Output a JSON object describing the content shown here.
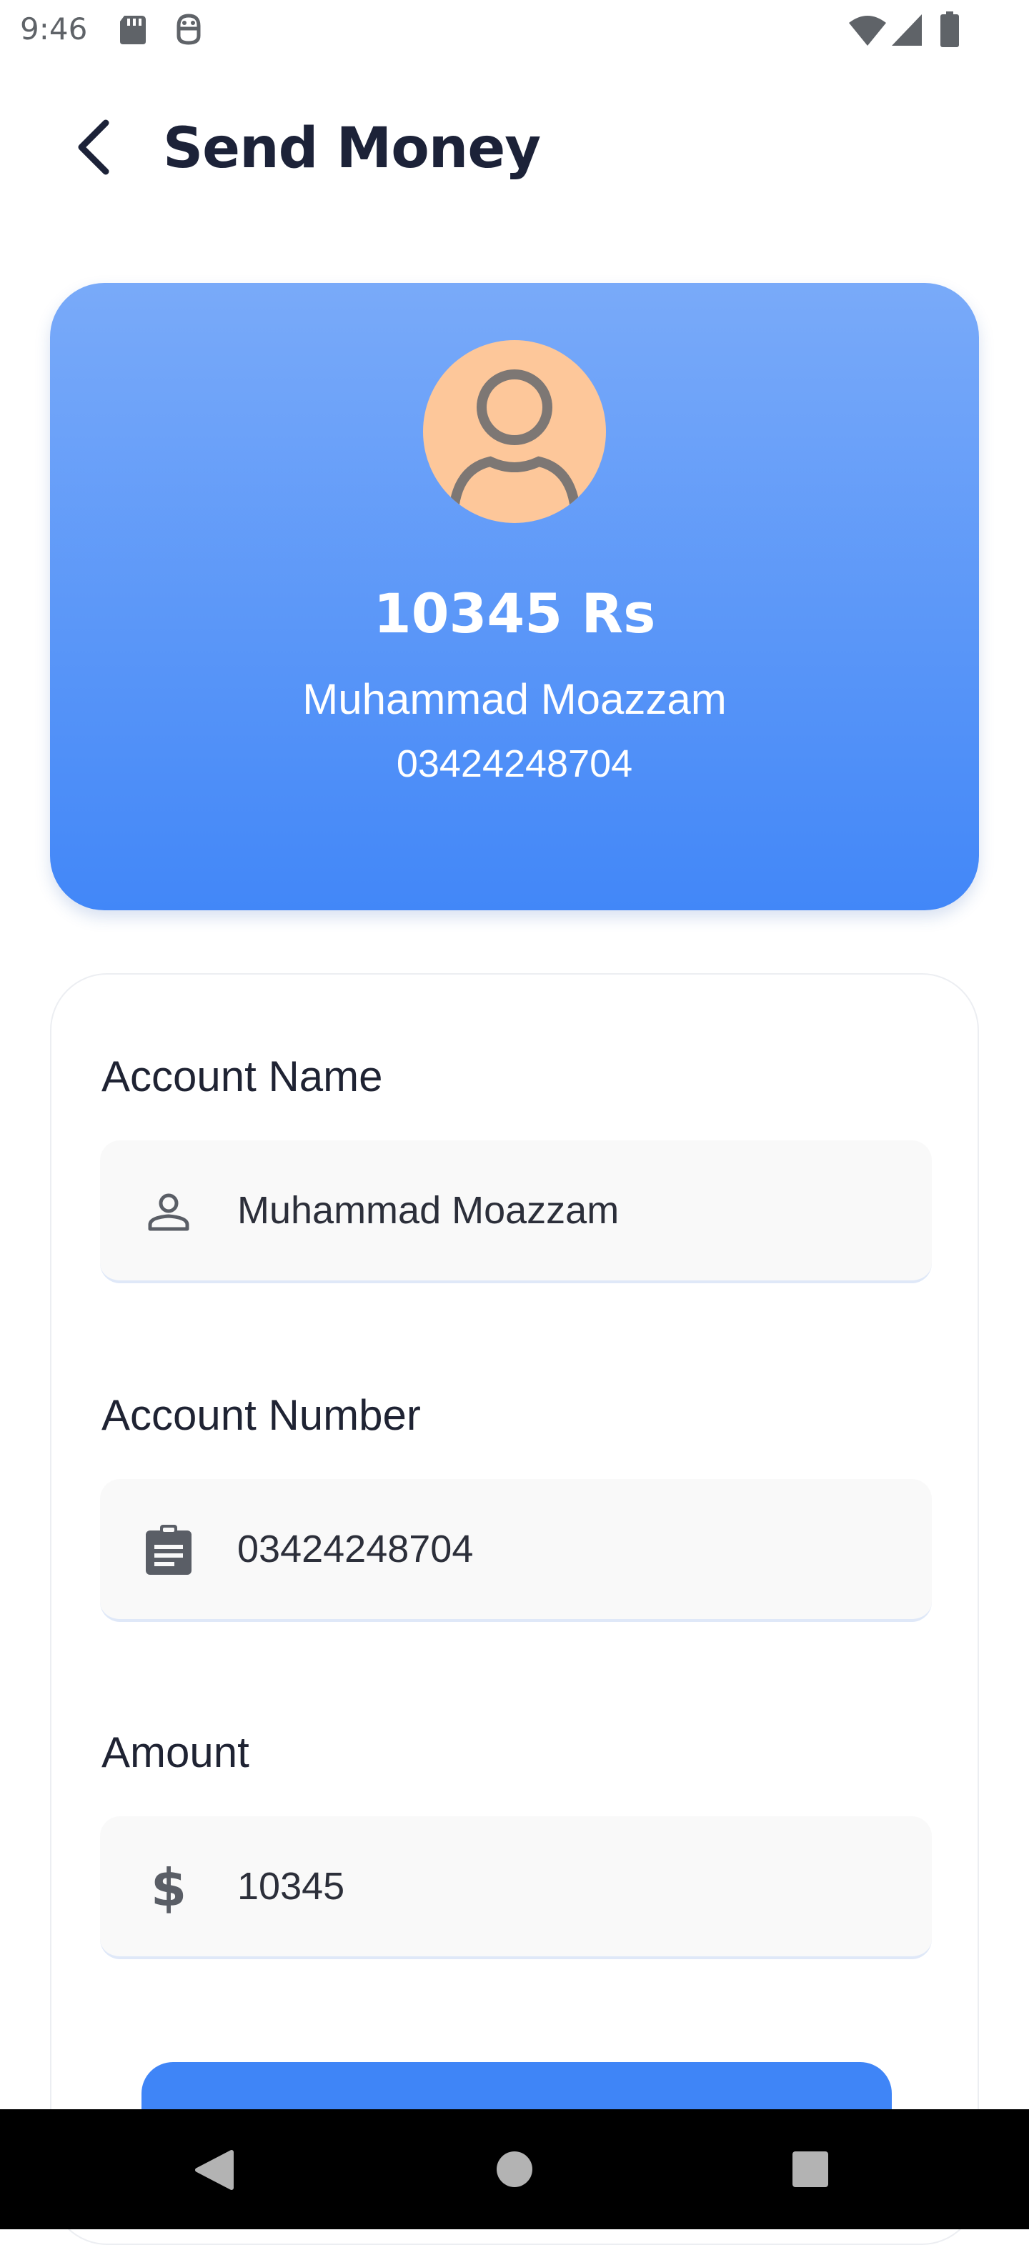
{
  "status_bar": {
    "time": "9:46",
    "icons": [
      "sd-card-icon",
      "android-debug-icon",
      "wifi-icon",
      "signal-icon",
      "battery-icon"
    ]
  },
  "header": {
    "title": "Send Money",
    "back_icon": "arrow-back-icon"
  },
  "recipient": {
    "avatar_icon": "person-icon",
    "avatar_color": "#fdc79a",
    "balance": "10345 Rs",
    "name": "Muhammad Moazzam",
    "number": "03424248704"
  },
  "form": {
    "fields": [
      {
        "label": "Account Name",
        "value": "Muhammad Moazzam",
        "icon": "person-outline-icon"
      },
      {
        "label": "Account Number",
        "value": "03424248704",
        "icon": "clipboard-icon"
      },
      {
        "label": "Amount",
        "value": "10345",
        "icon": "dollar-icon"
      }
    ]
  },
  "colors": {
    "accent": "#3f85f7",
    "card_gradient_top": "#79aaf9",
    "card_gradient_bottom": "#4287f8",
    "title": "#1c2238",
    "field_background": "#f9f9f9"
  },
  "nav": {
    "buttons": [
      "back-triangle-icon",
      "home-circle-icon",
      "recents-square-icon"
    ]
  }
}
